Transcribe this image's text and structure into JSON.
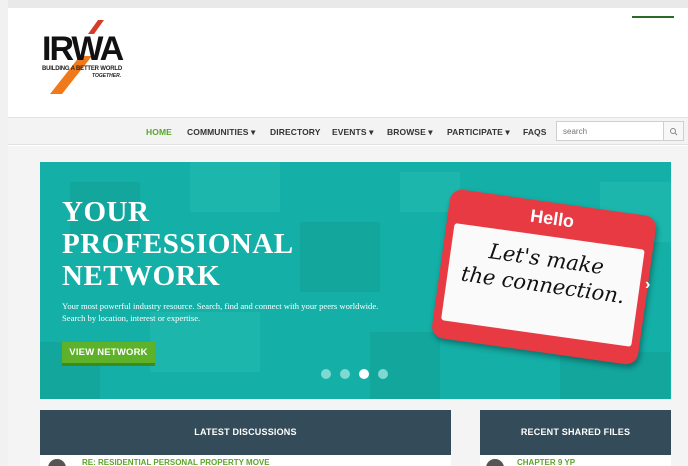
{
  "logo": {
    "name": "IRWA",
    "tagline_line1": "BUILDING A BETTER WORLD",
    "tagline_line2": "TOGETHER."
  },
  "nav": {
    "items": [
      "HOME",
      "COMMUNITIES ▾",
      "DIRECTORY",
      "EVENTS ▾",
      "BROWSE ▾",
      "PARTICIPATE ▾",
      "FAQS"
    ],
    "search_placeholder": "search"
  },
  "hero": {
    "title_lines": [
      "YOUR",
      "PROFESSIONAL",
      "NETWORK"
    ],
    "subtitle": "Your most powerful industry resource. Search, find and connect with your peers worldwide. Search by location, interest or expertise.",
    "button_label": "VIEW NETWORK",
    "sticker_hello": "Hello",
    "sticker_message_line1": "Let's make",
    "sticker_message_line2": "the connection.",
    "carousel": {
      "slides": 4,
      "active_slide": 3
    }
  },
  "panels": {
    "discussions": {
      "title": "LATEST DISCUSSIONS",
      "first_item": "RE: RESIDENTIAL PERSONAL PROPERTY MOVE"
    },
    "files": {
      "title": "RECENT SHARED FILES",
      "first_item": "CHAPTER 9 YP"
    }
  },
  "colors": {
    "accent_green": "#5aa52a",
    "hero_teal": "#14afa6",
    "panel_header": "#344b59",
    "sticker_red": "#e83a43"
  }
}
